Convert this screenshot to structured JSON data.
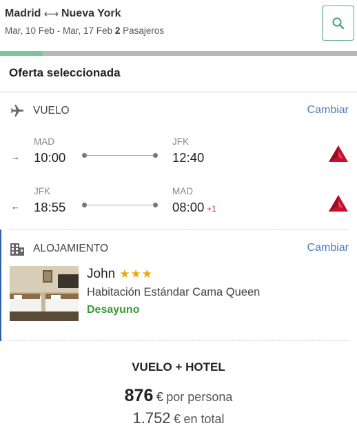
{
  "header": {
    "origin": "Madrid",
    "destination": "Nueva York",
    "round_trip_icon": "round-trip-arrows-icon",
    "dates": "Mar, 10 Feb - Mar, 17 Feb",
    "passengers_count": "2",
    "passengers_label": "Pasajeros",
    "search_icon": "search-icon",
    "progress_fraction": 0.12,
    "accent_color": "#4aaa78"
  },
  "offer": {
    "title": "Oferta seleccionada"
  },
  "flight": {
    "section_label": "VUELO",
    "icon": "airplane-icon",
    "change_label": "Cambiar",
    "legs": [
      {
        "direction_icon": "arrow-right-icon",
        "direction_glyph": "→",
        "from_code": "MAD",
        "from_time": "10:00",
        "to_code": "JFK",
        "to_time": "12:40",
        "day_offset": "",
        "airline_icon": "delta-logo-icon"
      },
      {
        "direction_icon": "arrow-left-icon",
        "direction_glyph": "←",
        "from_code": "JFK",
        "from_time": "18:55",
        "to_code": "MAD",
        "to_time": "08:00",
        "day_offset": "+1",
        "airline_icon": "delta-logo-icon"
      }
    ]
  },
  "hotel": {
    "section_label": "ALOJAMIENTO",
    "icon": "building-icon",
    "change_label": "Cambiar",
    "name": "John",
    "stars": 3,
    "stars_text": "★★★",
    "room_type": "Habitación Estándar Cama Queen",
    "board": "Desayuno"
  },
  "summary": {
    "title": "VUELO + HOTEL",
    "price_per_person": "876",
    "currency": "€",
    "per_person_label": "por persona",
    "total_amount": "1.752",
    "total_label": "en total"
  }
}
